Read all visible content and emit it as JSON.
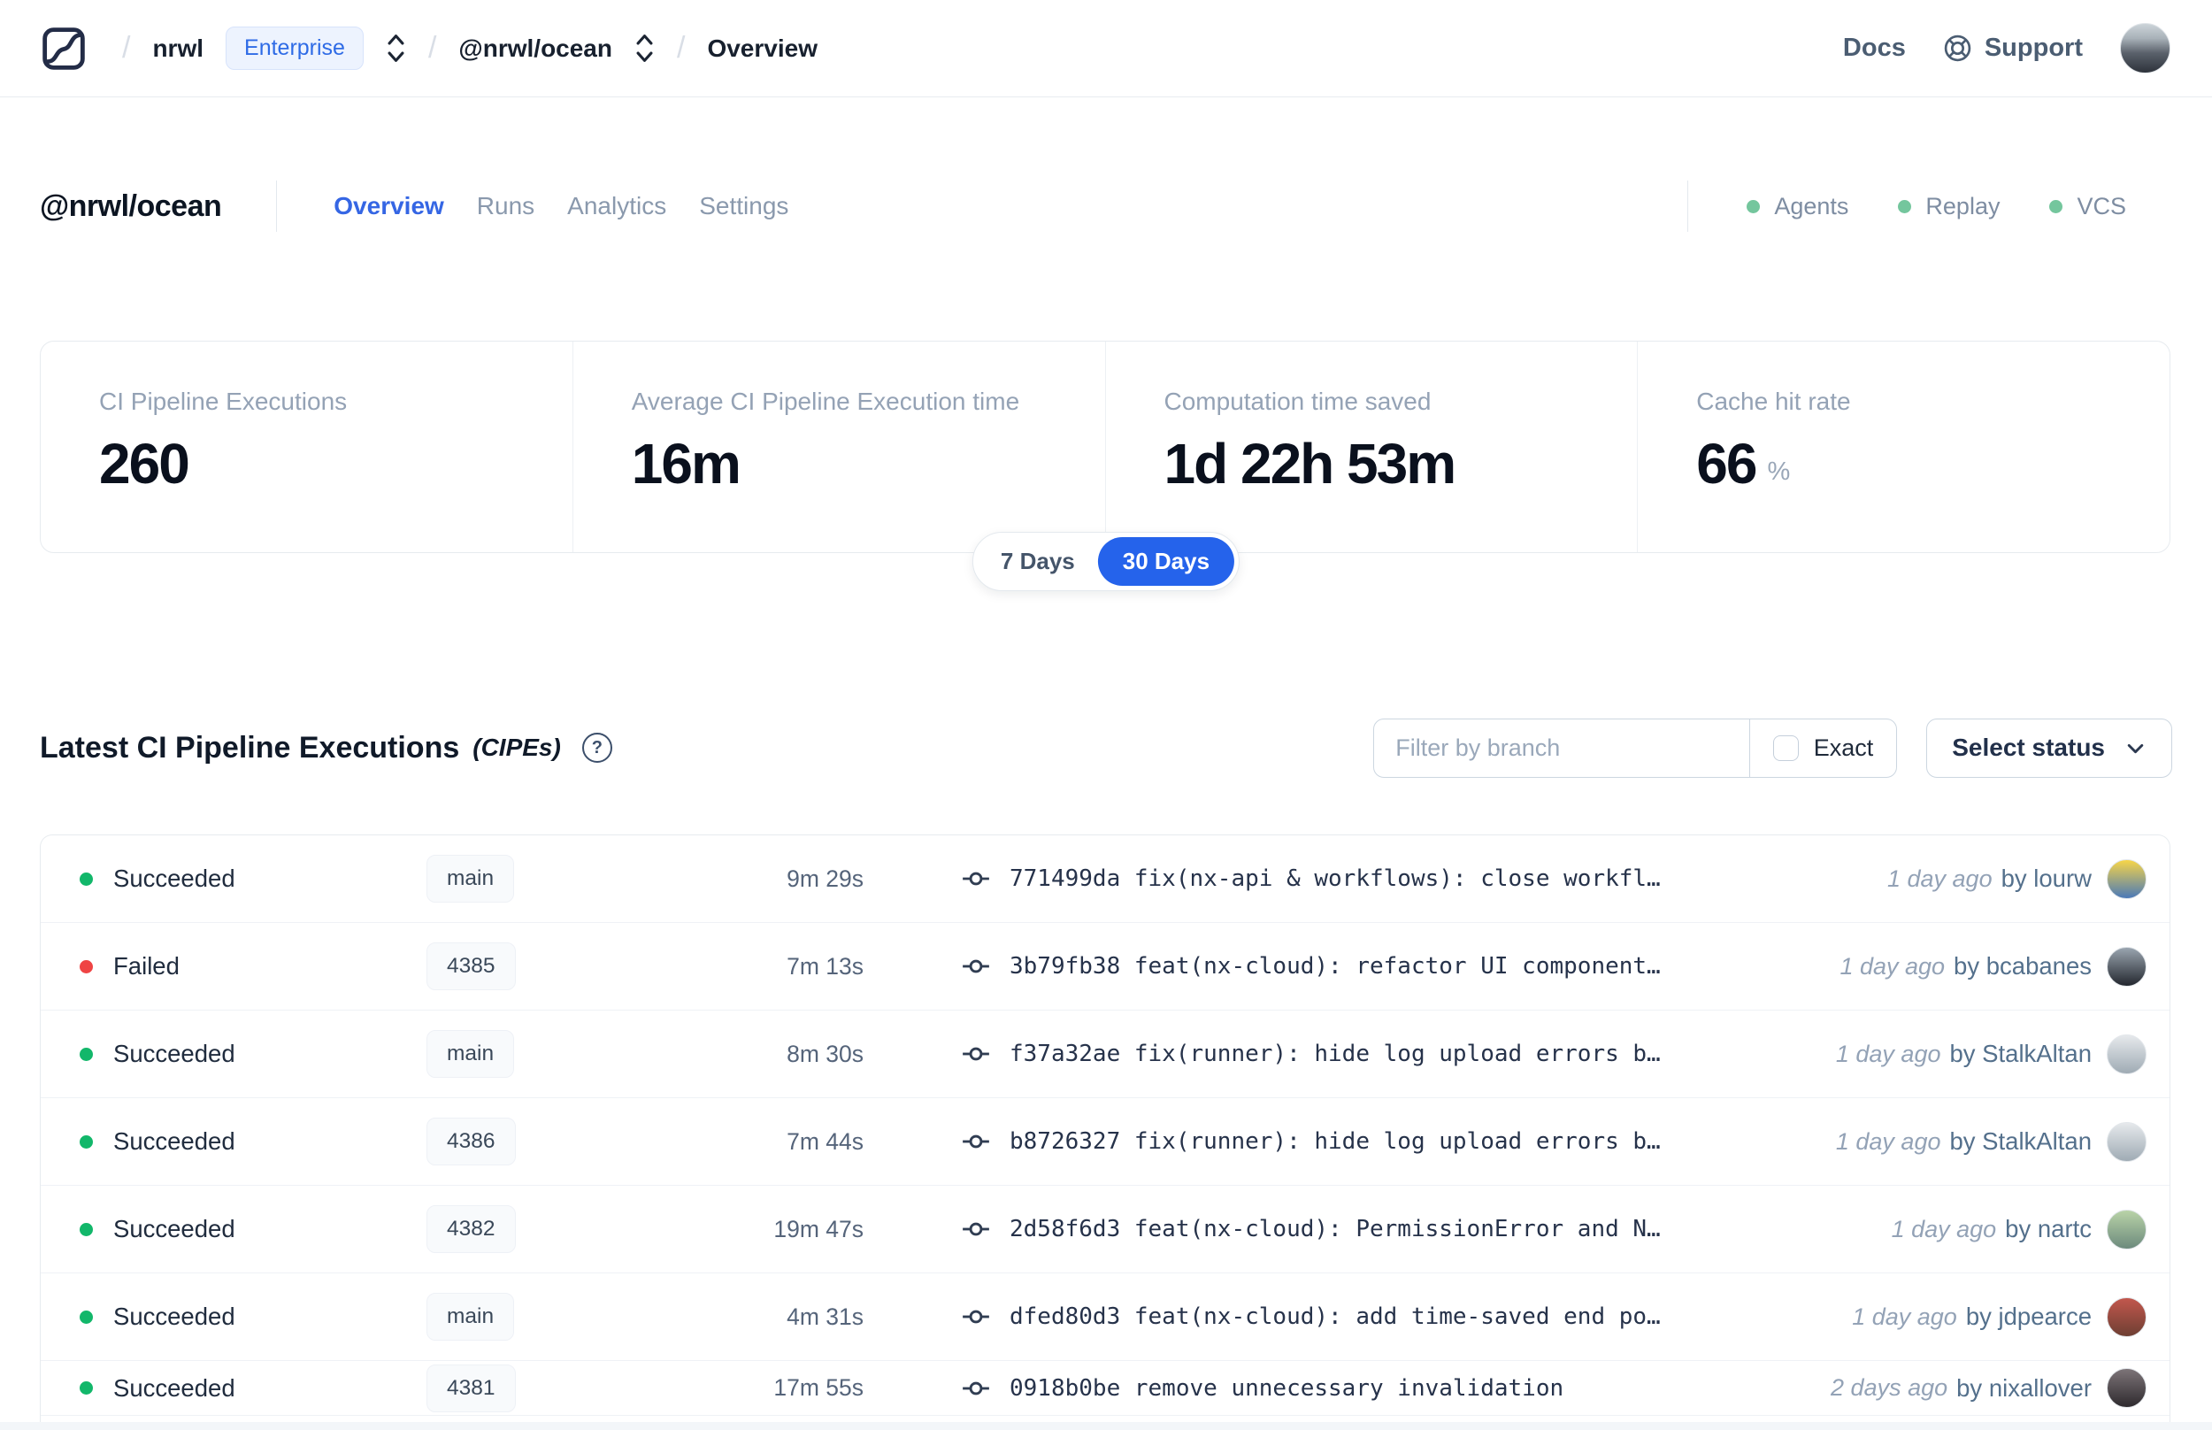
{
  "accent": {
    "blue": "#2563eb",
    "success_green": "#12b76a",
    "failed_red": "#ef4444",
    "indicator_green": "#74c69d"
  },
  "navbar": {
    "breadcrumb": {
      "separator": "/",
      "org": "nrwl",
      "org_badge": "Enterprise",
      "workspace": "@nrwl/ocean",
      "page": "Overview"
    },
    "docs_label": "Docs",
    "support_label": "Support"
  },
  "header": {
    "title": "@nrwl/ocean",
    "tabs": [
      {
        "label": "Overview",
        "active": true
      },
      {
        "label": "Runs",
        "active": false
      },
      {
        "label": "Analytics",
        "active": false
      },
      {
        "label": "Settings",
        "active": false
      }
    ],
    "indicators": [
      {
        "label": "Agents"
      },
      {
        "label": "Replay"
      },
      {
        "label": "VCS"
      }
    ]
  },
  "stats": {
    "cards": [
      {
        "label": "CI Pipeline Executions",
        "value": "260",
        "suffix": ""
      },
      {
        "label": "Average CI Pipeline Execution time",
        "value": "16m",
        "suffix": ""
      },
      {
        "label": "Computation time saved",
        "value": "1d 22h 53m",
        "suffix": ""
      },
      {
        "label": "Cache hit rate",
        "value": "66",
        "suffix": "%"
      }
    ],
    "range_toggle": {
      "options": [
        "7 Days",
        "30 Days"
      ],
      "selected": "30 Days"
    }
  },
  "cipes": {
    "title": "Latest CI Pipeline Executions",
    "title_suffix": "(CIPEs)",
    "filter_placeholder": "Filter by branch",
    "exact_label": "Exact",
    "status_button_label": "Select status",
    "rows": [
      {
        "status": "Succeeded",
        "branch": "main",
        "duration": "9m 29s",
        "commit": "771499da fix(nx-api & workflows): close workfl…",
        "time": "1 day ago",
        "author": "by lourw",
        "avatar": [
          "#f7d548",
          "#4a79b8"
        ]
      },
      {
        "status": "Failed",
        "branch": "4385",
        "duration": "7m 13s",
        "commit": "3b79fb38 feat(nx-cloud): refactor UI component…",
        "time": "1 day ago",
        "author": "by bcabanes",
        "avatar": [
          "#9aa5b0",
          "#23272e"
        ]
      },
      {
        "status": "Succeeded",
        "branch": "main",
        "duration": "8m 30s",
        "commit": "f37a32ae fix(runner): hide log upload errors b…",
        "time": "1 day ago",
        "author": "by StalkAltan",
        "avatar": [
          "#e6e9ec",
          "#9fabb4"
        ]
      },
      {
        "status": "Succeeded",
        "branch": "4386",
        "duration": "7m 44s",
        "commit": "b8726327 fix(runner): hide log upload errors b…",
        "time": "1 day ago",
        "author": "by StalkAltan",
        "avatar": [
          "#e6e9ec",
          "#9fabb4"
        ]
      },
      {
        "status": "Succeeded",
        "branch": "4382",
        "duration": "19m 47s",
        "commit": "2d58f6d3 feat(nx-cloud): PermissionError and N…",
        "time": "1 day ago",
        "author": "by nartc",
        "avatar": [
          "#b9d3a8",
          "#6c8a7d"
        ]
      },
      {
        "status": "Succeeded",
        "branch": "main",
        "duration": "4m 31s",
        "commit": "dfed80d3 feat(nx-cloud): add time-saved end po…",
        "time": "1 day ago",
        "author": "by jdpearce",
        "avatar": [
          "#c2574d",
          "#6e3f33"
        ]
      },
      {
        "status": "Succeeded",
        "branch": "4381",
        "duration": "17m 55s",
        "commit": "0918b0be remove unnecessary invalidation",
        "time": "2 days ago",
        "author": "by nixallover",
        "avatar": [
          "#7d7478",
          "#2e2a2e"
        ]
      }
    ]
  },
  "icons": {
    "logo": "nx-cloud-logo",
    "breadcrumb_selector": "up-down-chevrons-icon",
    "support": "lifebuoy-icon",
    "help": "question-circle-icon",
    "status_dropdown": "chevron-down-icon",
    "commit": "git-commit-icon"
  }
}
